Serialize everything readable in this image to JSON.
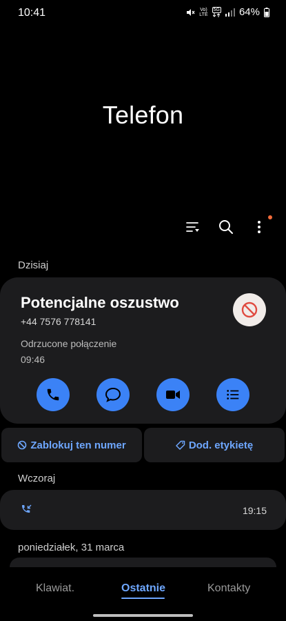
{
  "status_bar": {
    "time": "10:41",
    "volte": "Vo)",
    "lte": "LTE",
    "network": "5G",
    "battery": "64%"
  },
  "app": {
    "title": "Telefon"
  },
  "sections": {
    "today": "Dzisiaj",
    "yesterday": "Wczoraj",
    "monday": "poniedziałek, 31 marca"
  },
  "expanded_call": {
    "title": "Potencjalne oszustwo",
    "number": "+44 7576 778141",
    "status": "Odrzucone połączenie",
    "time": "09:46"
  },
  "actions": {
    "block_label": "Zablokuj ten numer",
    "tag_label": "Dod. etykietę"
  },
  "yesterday_call": {
    "time": "19:15"
  },
  "bottom_nav": {
    "tabs": [
      "Klawiat.",
      "Ostatnie",
      "Kontakty"
    ],
    "active": "Ostatnie"
  },
  "colors": {
    "accent": "#3b82f6",
    "accent_text": "#6ea7ff",
    "card": "#1c1c1e",
    "notification_dot": "#f26b3a",
    "block_red": "#e04a3f"
  }
}
